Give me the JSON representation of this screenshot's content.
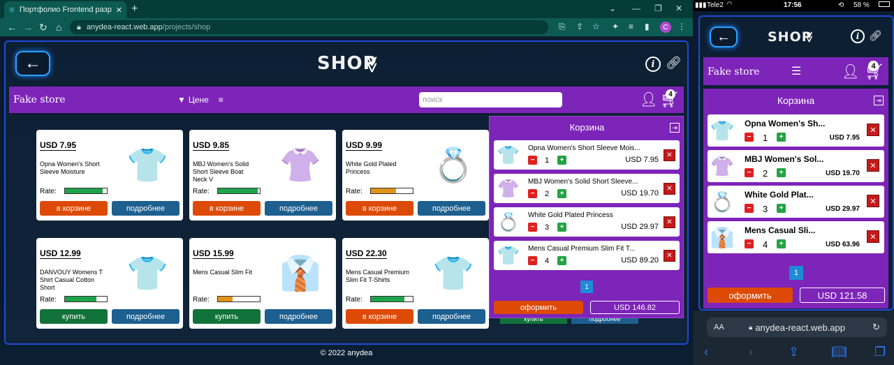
{
  "browser": {
    "tab_title": "Портфолио Frontend разрабо",
    "new_tab": "+",
    "url_host": "anydea-react.web.app",
    "url_path": "/projects/shop",
    "profile_initial": "C"
  },
  "header": {
    "title": "SHOP",
    "back_symbol": "←",
    "chevron_symbol": "≫",
    "info_symbol": "i"
  },
  "store_bar": {
    "brand": "Fake store",
    "filter_label": "Цене",
    "search_placeholder": "поиск",
    "cart_count": "4"
  },
  "products": [
    {
      "price": "USD 7.95",
      "title": "Opna Women's Short Sleeve Moisture",
      "rate": 0.9,
      "rate_color": "#1fa34a",
      "action": "в корзине",
      "action_style": "orange",
      "details": "подробнее",
      "emoji": "👕",
      "emoji_color": "#e8232e"
    },
    {
      "price": "USD 9.85",
      "title": "MBJ Women's Solid Short Sleeve Boat Neck V",
      "rate": 0.95,
      "rate_color": "#1fa34a",
      "action": "в корзине",
      "action_style": "orange",
      "details": "подробнее",
      "emoji": "👚",
      "emoji_color": "#cccccc"
    },
    {
      "price": "USD 9.99",
      "title": "White Gold Plated Princess",
      "rate": 0.6,
      "rate_color": "#e0931b",
      "action": "в корзине",
      "action_style": "orange",
      "details": "подробнее",
      "emoji": "💍",
      "emoji_color": "#aaaaaa"
    },
    {
      "price": "USD 12.99",
      "title": "DANVOUY Womens T Shirt Casual Cotton Short",
      "rate": 0.75,
      "rate_color": "#1fa34a",
      "action": "купить",
      "action_style": "green",
      "details": "подробнее",
      "emoji": "👕",
      "emoji_color": "#6b1d4a"
    },
    {
      "price": "USD 15.99",
      "title": "Mens Casual Slim Fit",
      "rate": 0.35,
      "rate_color": "#e0931b",
      "action": "купить",
      "action_style": "green",
      "details": "подробнее",
      "emoji": "👔",
      "emoji_color": "#2e3f66"
    },
    {
      "price": "USD 22.30",
      "title": "Mens Casual Premium Slim Fit T-Shirts",
      "rate": 0.8,
      "rate_color": "#1fa34a",
      "action": "в корзине",
      "action_style": "orange",
      "details": "подробнее",
      "emoji": "👕",
      "emoji_color": "#333333"
    }
  ],
  "hidden_row": {
    "action": "купить",
    "details": "подробнее"
  },
  "cart": {
    "title": "Корзина",
    "items": [
      {
        "title": "Opna Women's Short Sleeve Mois...",
        "qty": "1",
        "price": "USD 7.95",
        "emoji": "👕",
        "emoji_color": "#e8232e"
      },
      {
        "title": "MBJ Women's Solid Short Sleeve...",
        "qty": "2",
        "price": "USD 19.70",
        "emoji": "👚",
        "emoji_color": "#cccccc"
      },
      {
        "title": "White Gold Plated Princess",
        "qty": "3",
        "price": "USD 29.97",
        "emoji": "💍",
        "emoji_color": "#aaaaaa"
      },
      {
        "title": "Mens Casual Premium Slim Fit T...",
        "qty": "4",
        "price": "USD 89.20",
        "emoji": "👕",
        "emoji_color": "#333333"
      }
    ],
    "page": "1",
    "checkout": "оформить",
    "total": "USD 146.82",
    "minus": "−",
    "plus": "+",
    "delete": "✕"
  },
  "footer": "© 2022 anydea",
  "mobile": {
    "carrier": "Tele2",
    "time": "17:56",
    "battery": "58 %",
    "title": "SHOP",
    "brand": "Fake store",
    "cart_count": "4",
    "cart_title": "Корзина",
    "items": [
      {
        "title": "Opna Women's Sh...",
        "qty": "1",
        "price": "USD 7.95",
        "emoji": "👕",
        "emoji_color": "#e8232e"
      },
      {
        "title": "MBJ Women's Sol...",
        "qty": "2",
        "price": "USD 19.70",
        "emoji": "👚",
        "emoji_color": "#cccccc"
      },
      {
        "title": "White Gold Plat...",
        "qty": "3",
        "price": "USD 29.97",
        "emoji": "💍",
        "emoji_color": "#aaaaaa"
      },
      {
        "title": "Mens Casual Sli...",
        "qty": "4",
        "price": "USD 63.96",
        "emoji": "👔",
        "emoji_color": "#2e3f66"
      }
    ],
    "page": "1",
    "checkout": "оформить",
    "total": "USD 121.58",
    "text_size": "AA",
    "url": "anydea-react.web.app"
  },
  "colors": {
    "accent_purple": "#7d24b9",
    "frame_blue": "#1f4bd6",
    "cart_btn_orange": "#dd4a06",
    "details_blue": "#1d5f8f"
  }
}
